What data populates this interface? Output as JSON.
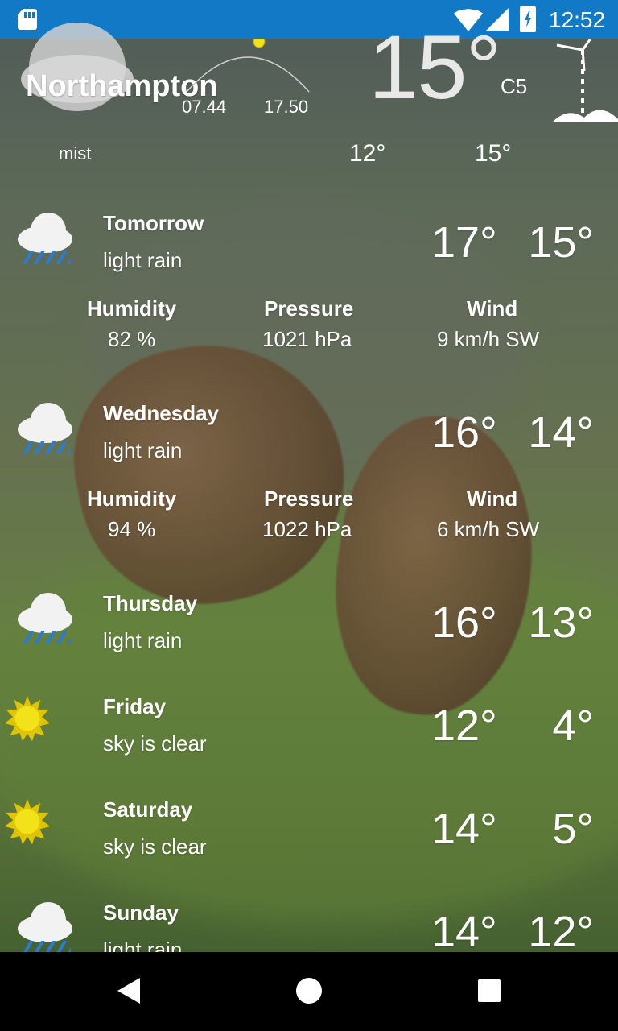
{
  "status_bar": {
    "time": "12:52",
    "icons": [
      "sd-card-icon",
      "wifi-icon",
      "cell-signal-icon",
      "battery-charging-icon"
    ]
  },
  "current": {
    "city": "Northampton",
    "temperature": "15°",
    "station": "C5",
    "condition": "mist",
    "sunrise": "07.44",
    "sunset": "17.50",
    "low": "12°",
    "high": "15°",
    "icon": "cloud-icon"
  },
  "forecast": [
    {
      "day": "Tomorrow",
      "desc": "light rain",
      "hi": "17°",
      "lo": "15°",
      "icon": "rain-cloud-icon",
      "details": {
        "humidity_label": "Humidity",
        "humidity": "82 %",
        "pressure_label": "Pressure",
        "pressure": "1021 hPa",
        "wind_label": "Wind",
        "wind": "9 km/h SW"
      }
    },
    {
      "day": "Wednesday",
      "desc": "light rain",
      "hi": "16°",
      "lo": "14°",
      "icon": "rain-cloud-icon",
      "details": {
        "humidity_label": "Humidity",
        "humidity": "94 %",
        "pressure_label": "Pressure",
        "pressure": "1022 hPa",
        "wind_label": "Wind",
        "wind": "6 km/h SW"
      }
    },
    {
      "day": "Thursday",
      "desc": "light rain",
      "hi": "16°",
      "lo": "13°",
      "icon": "rain-cloud-icon"
    },
    {
      "day": "Friday",
      "desc": "sky is clear",
      "hi": "12°",
      "lo": "4°",
      "icon": "sun-icon"
    },
    {
      "day": "Saturday",
      "desc": "sky is clear",
      "hi": "14°",
      "lo": "5°",
      "icon": "sun-icon"
    },
    {
      "day": "Sunday",
      "desc": "light rain",
      "hi": "14°",
      "lo": "12°",
      "icon": "rain-cloud-icon"
    }
  ],
  "nav": {
    "icons": [
      "back-icon",
      "home-icon",
      "recents-icon"
    ]
  },
  "colors": {
    "status_bar": "#1179c6",
    "rain": "#2a7bd1",
    "sun": "#f2e21a"
  }
}
